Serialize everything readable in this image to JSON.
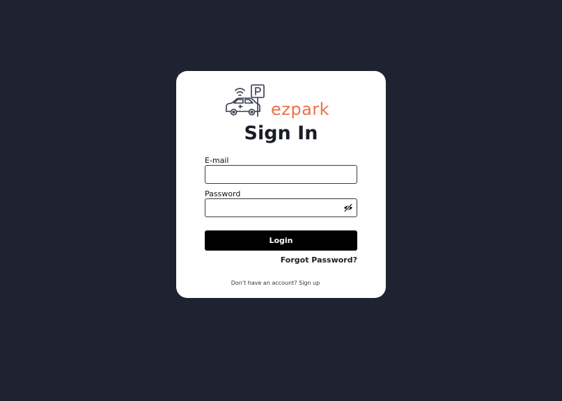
{
  "brand": {
    "name": "ezpark",
    "logo_icon": "car-parking-icon",
    "accent_color": "#ef7046"
  },
  "page": {
    "title": "Sign In",
    "background_color": "#1e2331"
  },
  "form": {
    "email_label": "E-mail",
    "email_value": "",
    "password_label": "Password",
    "password_value": "",
    "password_toggle_icon": "eye-slash-icon",
    "login_label": "Login",
    "forgot_label": "Forgot Password?"
  },
  "signup": {
    "prompt": "Don't have an account? ",
    "link_label": "Sign up"
  }
}
